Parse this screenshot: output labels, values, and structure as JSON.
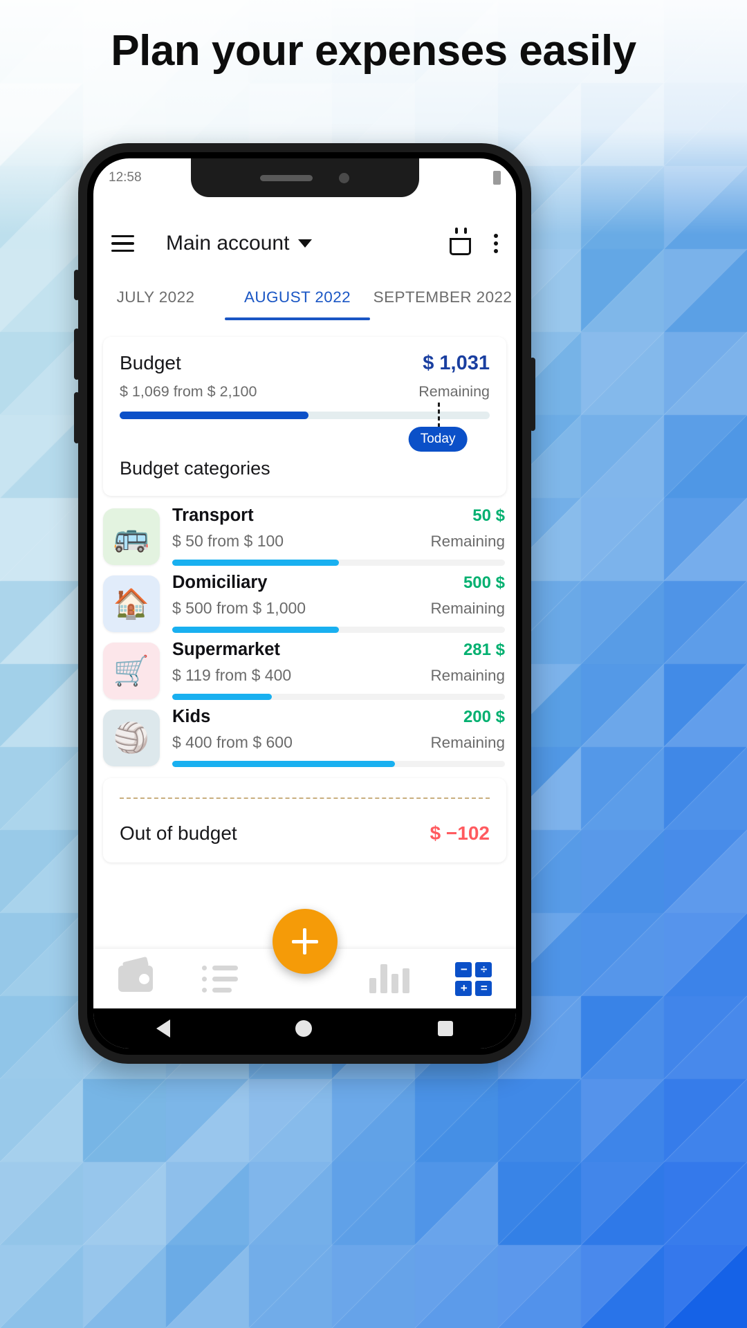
{
  "headline": "Plan your expenses easily",
  "theme": {
    "accent_blue": "#1a56c4",
    "bar_blue": "#0b50c8",
    "category_bar_blue": "#19b0f0",
    "green": "#03b070",
    "red": "#ff5a5f",
    "fab_orange": "#f59b08",
    "page_bg": "#eaf7fc"
  },
  "phone": {
    "status": {
      "time": "12:58",
      "battery_icon": "battery-icon"
    },
    "appbar": {
      "menu_icon": "hamburger-menu-icon",
      "account_label": "Main account",
      "dropdown_icon": "chevron-down-icon",
      "calendar_icon": "calendar-icon",
      "overflow_icon": "more-vertical-icon"
    },
    "tabs": [
      {
        "label": "JULY 2022",
        "active": false
      },
      {
        "label": "AUGUST 2022",
        "active": true
      },
      {
        "label": "SEPTEMBER 2022",
        "active": false
      }
    ],
    "budget": {
      "title": "Budget",
      "amount": "$ 1,031",
      "spent_of": "$ 1,069 from $ 2,100",
      "remaining_label": "Remaining",
      "progress_percent": 51,
      "today_marker_percent": 86,
      "today_label": "Today",
      "categories_heading": "Budget categories"
    },
    "categories": [
      {
        "name": "Transport",
        "icon": "bus-icon",
        "emoji": "🚌",
        "icon_bg": "#e3f3e0",
        "spent_of": "$ 50 from $ 100",
        "remaining": "50 $",
        "remaining_label": "Remaining",
        "progress_percent": 50
      },
      {
        "name": "Domiciliary",
        "icon": "house-icon",
        "emoji": "🏠",
        "icon_bg": "#e1ecfa",
        "spent_of": "$ 500 from $ 1,000",
        "remaining": "500 $",
        "remaining_label": "Remaining",
        "progress_percent": 50
      },
      {
        "name": "Supermarket",
        "icon": "shopping-cart-icon",
        "emoji": "🛒",
        "icon_bg": "#fce6ea",
        "spent_of": "$ 119 from $ 400",
        "remaining": "281 $",
        "remaining_label": "Remaining",
        "progress_percent": 30
      },
      {
        "name": "Kids",
        "icon": "beach-ball-icon",
        "emoji": "🏐",
        "icon_bg": "#dde8ec",
        "spent_of": "$ 400 from $ 600",
        "remaining": "200 $",
        "remaining_label": "Remaining",
        "progress_percent": 67
      }
    ],
    "out_of_budget": {
      "label": "Out of budget",
      "value": "$ −102"
    },
    "fab": {
      "icon": "plus-icon",
      "label": "+"
    },
    "bottom_nav": [
      {
        "icon": "wallet-icon",
        "active": false
      },
      {
        "icon": "list-icon",
        "active": false
      },
      {
        "icon": "bar-chart-icon",
        "active": false
      },
      {
        "icon": "calculator-icon",
        "active": true
      }
    ],
    "calculator_keys": [
      "−",
      "÷",
      "+",
      "="
    ],
    "android_nav": [
      "back-icon",
      "home-icon",
      "recents-icon"
    ]
  }
}
